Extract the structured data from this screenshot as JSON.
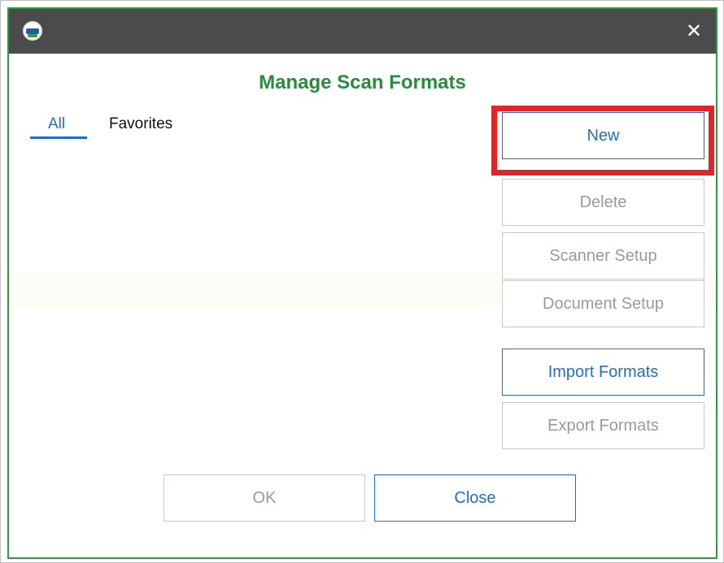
{
  "window": {
    "title": "Manage Scan Formats",
    "close_glyph": "✕"
  },
  "tabs": [
    {
      "label": "All",
      "selected": true
    },
    {
      "label": "Favorites",
      "selected": false
    }
  ],
  "side_buttons": [
    {
      "label": "New",
      "enabled": true,
      "highlighted": true
    },
    {
      "label": "Delete",
      "enabled": false
    },
    {
      "label": "Scanner Setup",
      "enabled": false
    },
    {
      "label": "Document Setup",
      "enabled": false
    },
    {
      "label": "Import Formats",
      "enabled": true
    },
    {
      "label": "Export Formats",
      "enabled": false
    }
  ],
  "footer_buttons": [
    {
      "label": "OK",
      "enabled": false
    },
    {
      "label": "Close",
      "enabled": true
    }
  ],
  "colors": {
    "title_green": "#2a8b3c",
    "accent_blue": "#1f6fc6",
    "highlight_red": "#e3232a",
    "titlebar": "#4b4b4b",
    "window_border": "#2f9a41"
  },
  "icons": {
    "app": "app-logo-icon",
    "close": "close-icon"
  }
}
